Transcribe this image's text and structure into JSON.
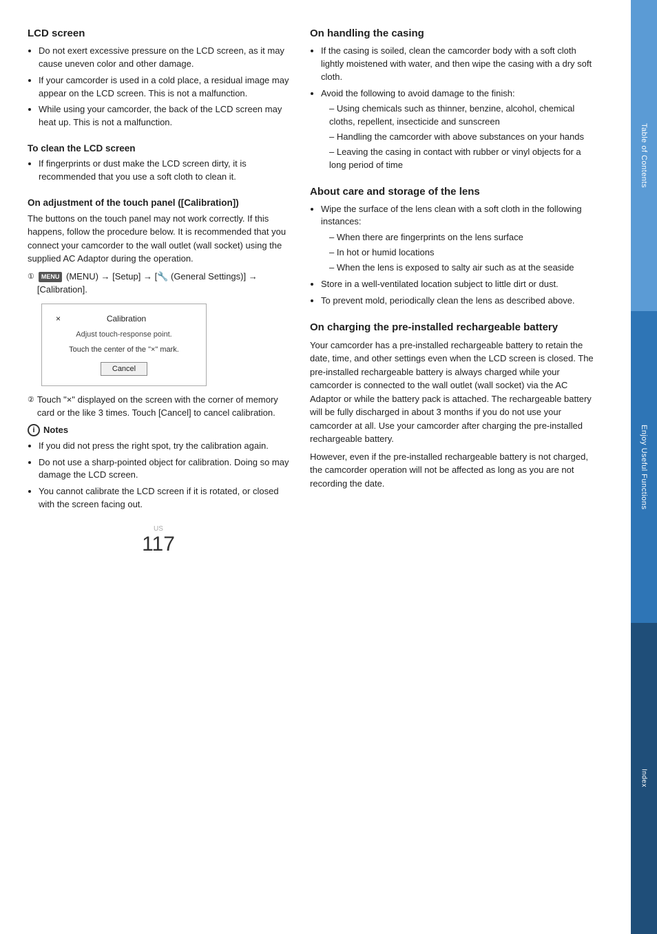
{
  "sidebar": {
    "sections": [
      {
        "id": "toc",
        "label": "Table of Contents",
        "color": "#6baed6"
      },
      {
        "id": "enjoy",
        "label": "Enjoy Useful Functions",
        "color": "#2171b5"
      },
      {
        "id": "index",
        "label": "Index",
        "color": "#1f4e79"
      }
    ]
  },
  "left": {
    "lcd_screen": {
      "heading": "LCD screen",
      "bullets": [
        "Do not exert excessive pressure on the LCD screen, as it may cause uneven color and other damage.",
        "If your camcorder is used in a cold place, a residual image may appear on the LCD screen. This is not a malfunction.",
        "While using your camcorder, the back of the LCD screen may heat up. This is not a malfunction."
      ]
    },
    "clean_lcd": {
      "heading": "To clean the LCD screen",
      "bullets": [
        "If fingerprints or dust make the LCD screen dirty, it is recommended that you use a soft cloth to clean it."
      ]
    },
    "touch_panel": {
      "heading": "On adjustment of the touch panel ([Calibration])",
      "intro": "The buttons on the touch panel may not work correctly. If this happens, follow the procedure below. It is recommended that you connect your camcorder to the wall outlet (wall socket) using the supplied AC Adaptor during the operation.",
      "step1_prefix": "(MENU) → [Setup] → [",
      "step1_icon": "MENU",
      "step1_suffix": " (General Settings)] → [Calibration].",
      "calibration_box": {
        "close": "×",
        "title": "Calibration",
        "subtitle": "Adjust touch-response point.",
        "instruction": "Touch the center of the \"×\" mark.",
        "cancel_label": "Cancel"
      },
      "step2": "Touch \"×\" displayed on the screen with the corner of memory card or the like 3 times. Touch [Cancel] to cancel calibration.",
      "notes_heading": "Notes",
      "notes": [
        "If you did not press the right spot, try the calibration again.",
        "Do not use a sharp-pointed object for calibration. Doing so may damage the LCD screen.",
        "You cannot calibrate the LCD screen if it is rotated, or closed with the screen facing out."
      ]
    }
  },
  "right": {
    "handling_casing": {
      "heading": "On handling the casing",
      "bullets": [
        "If the casing is soiled, clean the camcorder body with a soft cloth lightly moistened with water, and then wipe the casing with a dry soft cloth.",
        "Avoid the following to avoid damage to the finish:"
      ],
      "sub_bullets": [
        "Using chemicals such as thinner, benzine, alcohol, chemical cloths, repellent, insecticide and sunscreen",
        "Handling the camcorder with above substances on your hands",
        "Leaving the casing in contact with rubber or vinyl objects for a long period of time"
      ]
    },
    "care_lens": {
      "heading": "About care and storage of the lens",
      "bullets": [
        "Wipe the surface of the lens clean with a soft cloth in the following instances:"
      ],
      "sub_bullets_lens": [
        "When there are fingerprints on the lens surface",
        "In hot or humid locations",
        "When the lens is exposed to salty air such as at the seaside"
      ],
      "bullets2": [
        "Store in a well-ventilated location subject to little dirt or dust.",
        "To prevent mold, periodically clean the lens as described above."
      ]
    },
    "rechargeable": {
      "heading": "On charging the pre-installed rechargeable battery",
      "para1": "Your camcorder has a pre-installed rechargeable battery to retain the date, time, and other settings even when the LCD screen is closed. The pre-installed rechargeable battery is always charged while your camcorder is connected to the wall outlet (wall socket) via the AC Adaptor or while the battery pack is attached. The rechargeable battery will be fully discharged in about 3 months if you do not use your camcorder at all. Use your camcorder after charging the pre-installed rechargeable battery.",
      "para2": "However, even if the pre-installed rechargeable battery is not charged, the camcorder operation will not be affected as long as you are not recording the date."
    }
  },
  "footer": {
    "page_label": "US",
    "page_number": "117"
  }
}
